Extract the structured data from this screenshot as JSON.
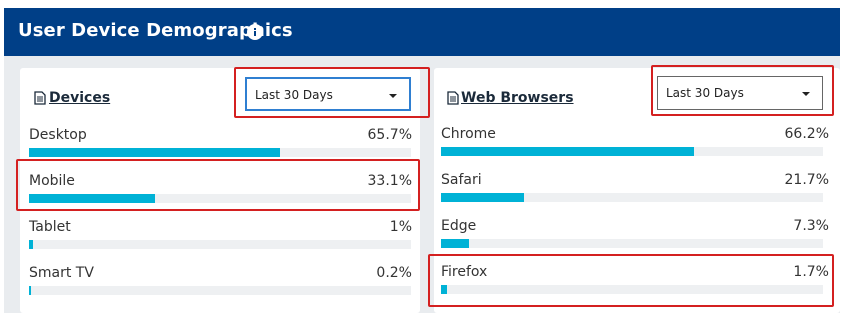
{
  "header": {
    "title": "User Device Demographics",
    "info_icon": "info-circle-icon"
  },
  "devices": {
    "title": "Devices",
    "icon": "document-icon",
    "dropdown": {
      "selected": "Last 30 Days"
    },
    "rows": [
      {
        "label": "Desktop",
        "value": "65.7%",
        "fraction": 0.657
      },
      {
        "label": "Mobile",
        "value": "33.1%",
        "fraction": 0.331
      },
      {
        "label": "Tablet",
        "value": "1%",
        "fraction": 0.01
      },
      {
        "label": "Smart TV",
        "value": "0.2%",
        "fraction": 0.002
      }
    ]
  },
  "browsers": {
    "title": "Web Browsers",
    "icon": "document-icon",
    "dropdown": {
      "selected": "Last 30 Days"
    },
    "rows": [
      {
        "label": "Chrome",
        "value": "66.2%",
        "fraction": 0.662
      },
      {
        "label": "Safari",
        "value": "21.7%",
        "fraction": 0.217
      },
      {
        "label": "Edge",
        "value": "7.3%",
        "fraction": 0.073
      },
      {
        "label": "Firefox",
        "value": "1.7%",
        "fraction": 0.017
      }
    ]
  },
  "colors": {
    "header_bg": "#003f87",
    "bar_fill": "#00b2d6",
    "highlight": "#d42020"
  }
}
